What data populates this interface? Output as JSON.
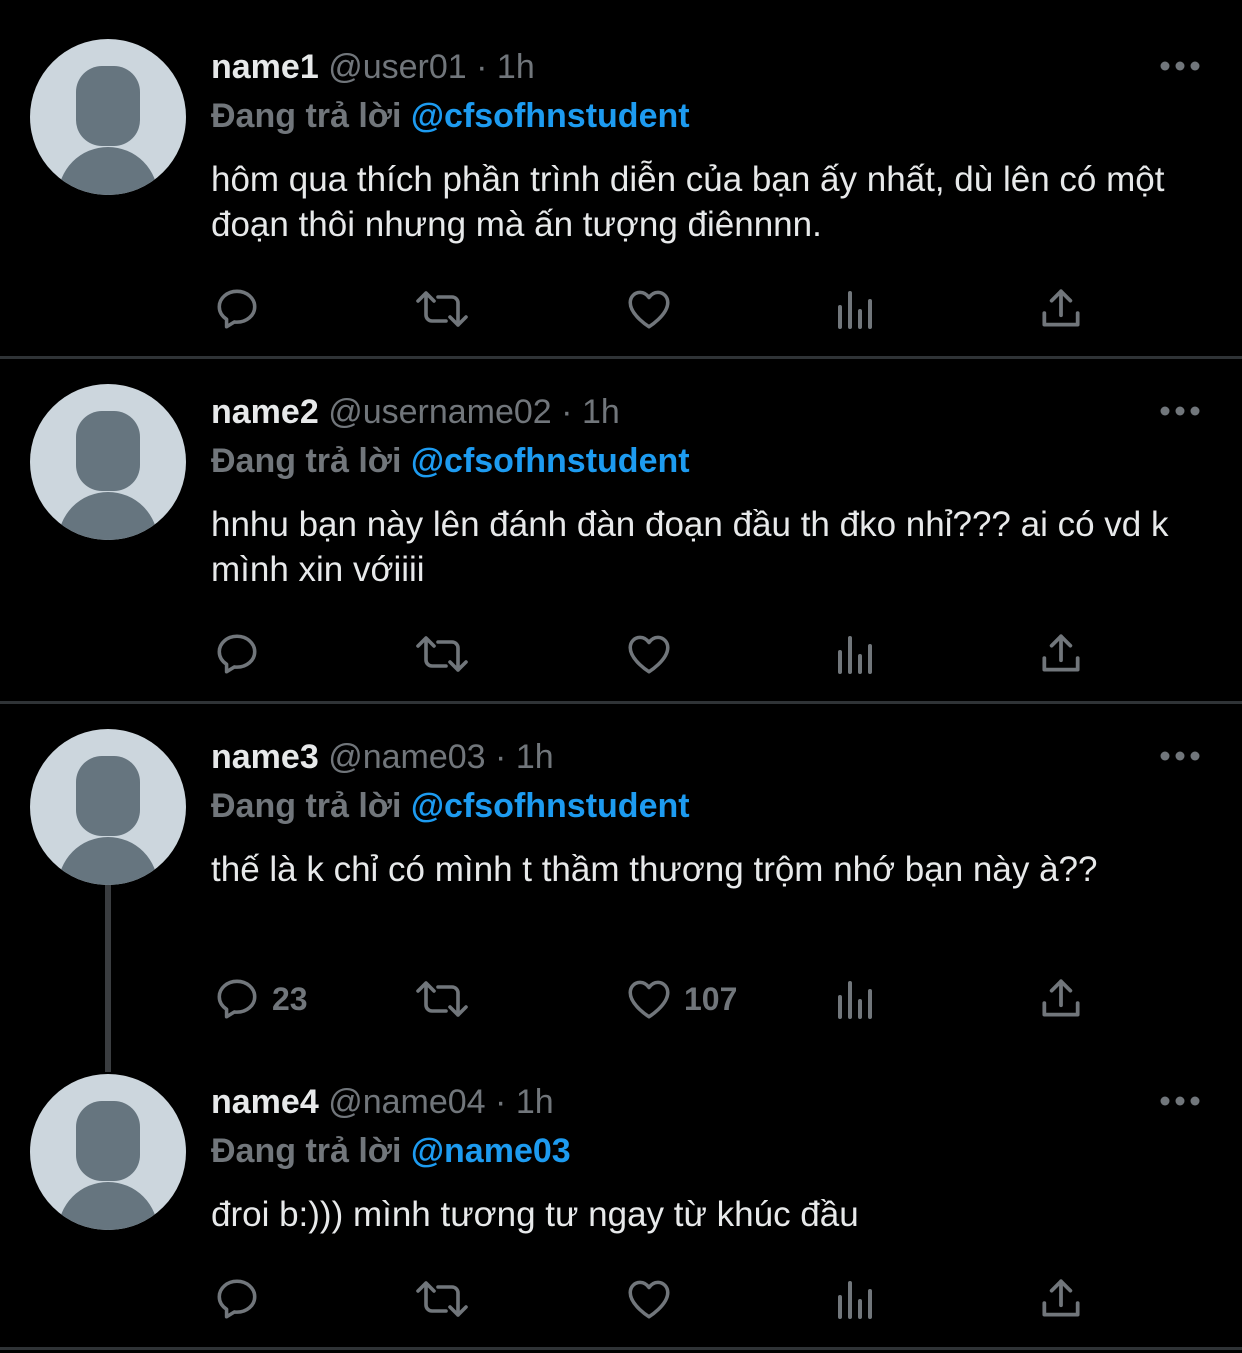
{
  "colors": {
    "background": "#000000",
    "text": "#e7e9ea",
    "muted": "#71767b",
    "link": "#1d9bf0",
    "divider": "#2f3336"
  },
  "tweets": [
    {
      "name": "name1",
      "handle": "@user01",
      "sep": "·",
      "time": "1h",
      "reply_label": "Đang trả lời",
      "reply_to": "@cfsofhnstudent",
      "text": "hôm qua thích phần trình diễn của bạn ấy nhất, dù lên có một đoạn thôi nhưng mà ấn tượng điênnnn.",
      "reply_count": "",
      "like_count": ""
    },
    {
      "name": "name2",
      "handle": "@username02",
      "sep": "·",
      "time": "1h",
      "reply_label": "Đang trả lời",
      "reply_to": "@cfsofhnstudent",
      "text": "hnhu bạn này lên đánh đàn đoạn đầu th đko nhỉ??? ai có vd k mình xin vớiiii",
      "reply_count": "",
      "like_count": ""
    },
    {
      "name": "name3",
      "handle": "@name03",
      "sep": "·",
      "time": "1h",
      "reply_label": "Đang trả lời",
      "reply_to": "@cfsofhnstudent",
      "text": "thế là k chỉ có mình t thầm thương trộm nhớ bạn này à??",
      "reply_count": "23",
      "like_count": "107"
    },
    {
      "name": "name4",
      "handle": "@name04",
      "sep": "·",
      "time": "1h",
      "reply_label": "Đang trả lời",
      "reply_to": "@name03",
      "text": "đroi b:))) mình tương tư ngay từ khúc đầu",
      "reply_count": "",
      "like_count": ""
    }
  ]
}
